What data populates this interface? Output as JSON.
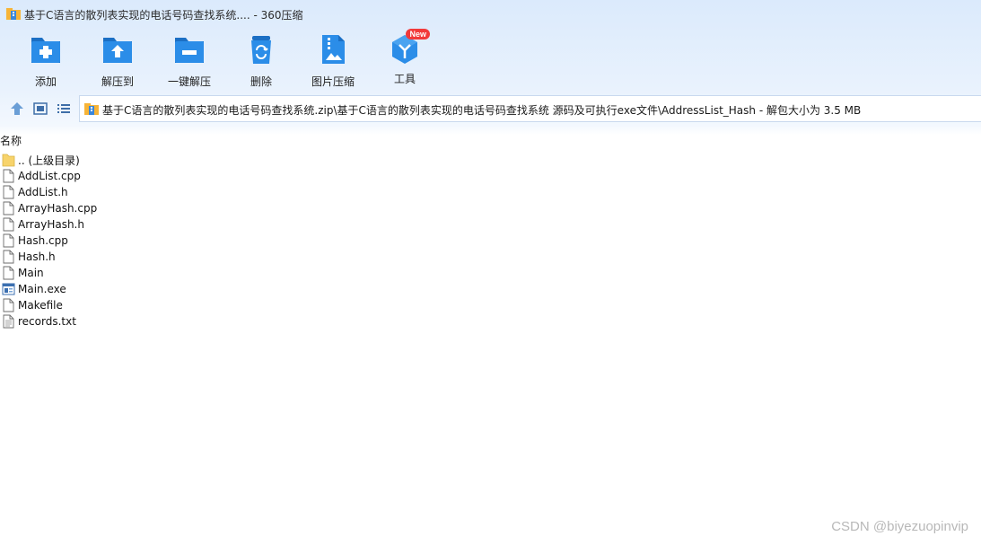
{
  "window": {
    "title": "基于C语言的散列表实现的电话号码查找系统.... - 360压缩",
    "app_icon": "archive-icon"
  },
  "toolbar": {
    "items": [
      {
        "label": "添加",
        "icon": "add-folder-icon"
      },
      {
        "label": "解压到",
        "icon": "extract-to-icon"
      },
      {
        "label": "一键解压",
        "icon": "one-click-extract-icon"
      },
      {
        "label": "删除",
        "icon": "delete-icon"
      },
      {
        "label": "图片压缩",
        "icon": "image-compress-icon"
      },
      {
        "label": "工具",
        "icon": "tools-icon",
        "badge": "New"
      }
    ]
  },
  "nav": {
    "up_icon": "up-arrow-icon",
    "view_icon": "view-mode-icon",
    "list_icon": "list-view-icon",
    "path": "基于C语言的散列表实现的电话号码查找系统.zip\\基于C语言的散列表实现的电话号码查找系统 源码及可执行exe文件\\AddressList_Hash - 解包大小为 3.5 MB"
  },
  "list": {
    "column_name": "名称",
    "files": [
      {
        "name": ".. (上级目录)",
        "type": "folder"
      },
      {
        "name": "AddList.cpp",
        "type": "file"
      },
      {
        "name": "AddList.h",
        "type": "file"
      },
      {
        "name": "ArrayHash.cpp",
        "type": "file"
      },
      {
        "name": "ArrayHash.h",
        "type": "file"
      },
      {
        "name": "Hash.cpp",
        "type": "file"
      },
      {
        "name": "Hash.h",
        "type": "file"
      },
      {
        "name": "Main",
        "type": "file"
      },
      {
        "name": "Main.exe",
        "type": "exe"
      },
      {
        "name": "Makefile",
        "type": "file"
      },
      {
        "name": "records.txt",
        "type": "text"
      }
    ]
  },
  "watermark": "CSDN @biyezuopinvip",
  "colors": {
    "accent": "#2b8de8",
    "accent_dark": "#1b6fc4",
    "badge": "#f23a3a",
    "folder": "#f7d36b"
  }
}
